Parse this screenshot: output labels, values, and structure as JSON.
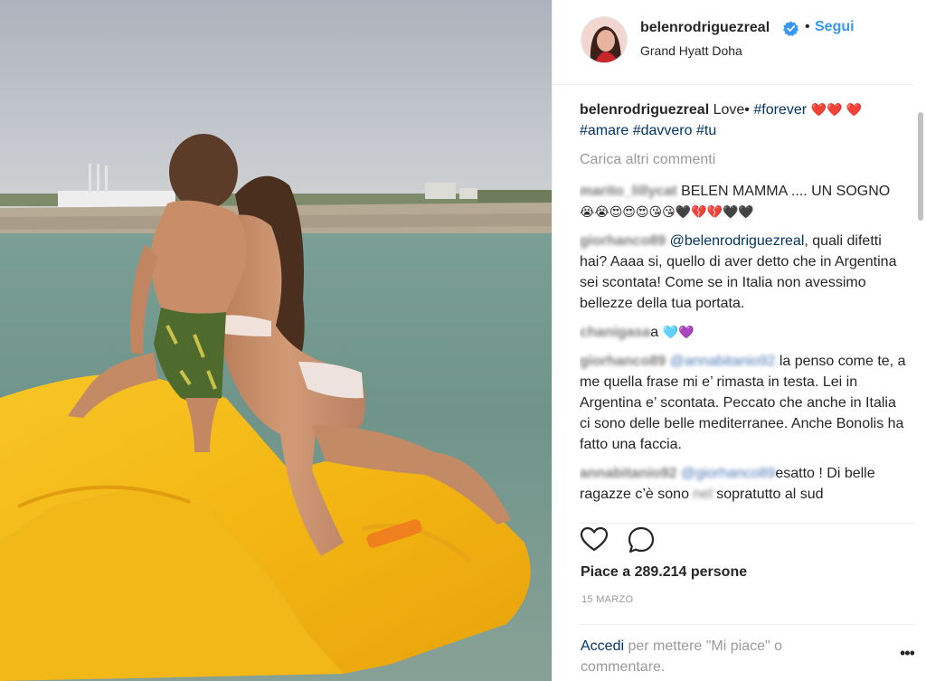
{
  "post": {
    "author": "belenrodriguezreal",
    "follow_label": "Segui",
    "separator": "•",
    "location": "Grand Hyatt Doha",
    "caption": {
      "username": "belenrodriguezreal",
      "text_before": "Love•",
      "hashtags": [
        "#forever",
        "#amare",
        "#davvero",
        "#tu"
      ],
      "emojis": [
        "❤️",
        "❤️",
        "❤️"
      ]
    },
    "load_more_label": "Carica altri commenti",
    "comments": [
      {
        "username": "marito_lillycat",
        "text": "BELEN MAMMA .... UN SOGNO",
        "emojis": "😭😭😍😍😍😘😘🖤💔💔🖤🖤"
      },
      {
        "username": "giorhanco89",
        "mention": "@belenrodriguezreal",
        "text": ", quali difetti hai? Aaaa si, quello di aver detto che in Argentina sei scontata! Come se in Italia non avessimo bellezze della tua portata."
      },
      {
        "username": "chanigasa",
        "text": "a",
        "emojis": "🩵💜"
      },
      {
        "username": "giorhanco89",
        "mention": "@annabitanio92",
        "text": " la penso come te, a me quella frase mi e’ rimasta in testa. Lei in Argentina e’ scontata. Peccato che anche in Italia ci sono delle belle mediterranee. Anche Bonolis ha fatto una faccia."
      },
      {
        "username": "annabitanio92",
        "mention": "@giorhanco89",
        "text": "esatto ! Di belle ragazze c’è sono",
        "blurred": "nel",
        "text_after": "sopratutto al sud"
      }
    ],
    "likes_label": "Piace a 289.214 persone",
    "date": "15 MARZO",
    "login_link": "Accedi",
    "login_text": "per mettere \"Mi piace\" o commentare.",
    "more_label": "•••"
  },
  "colors": {
    "link": "#003569",
    "follow": "#3897f0",
    "muted": "#999999",
    "text": "#262626",
    "verified": "#3897f0",
    "heart_emoji": "#ed1c3b"
  },
  "icons": {
    "like": "heart-outline-icon",
    "comment": "speech-bubble-icon",
    "verified": "verified-badge-icon",
    "more": "ellipsis-icon"
  }
}
